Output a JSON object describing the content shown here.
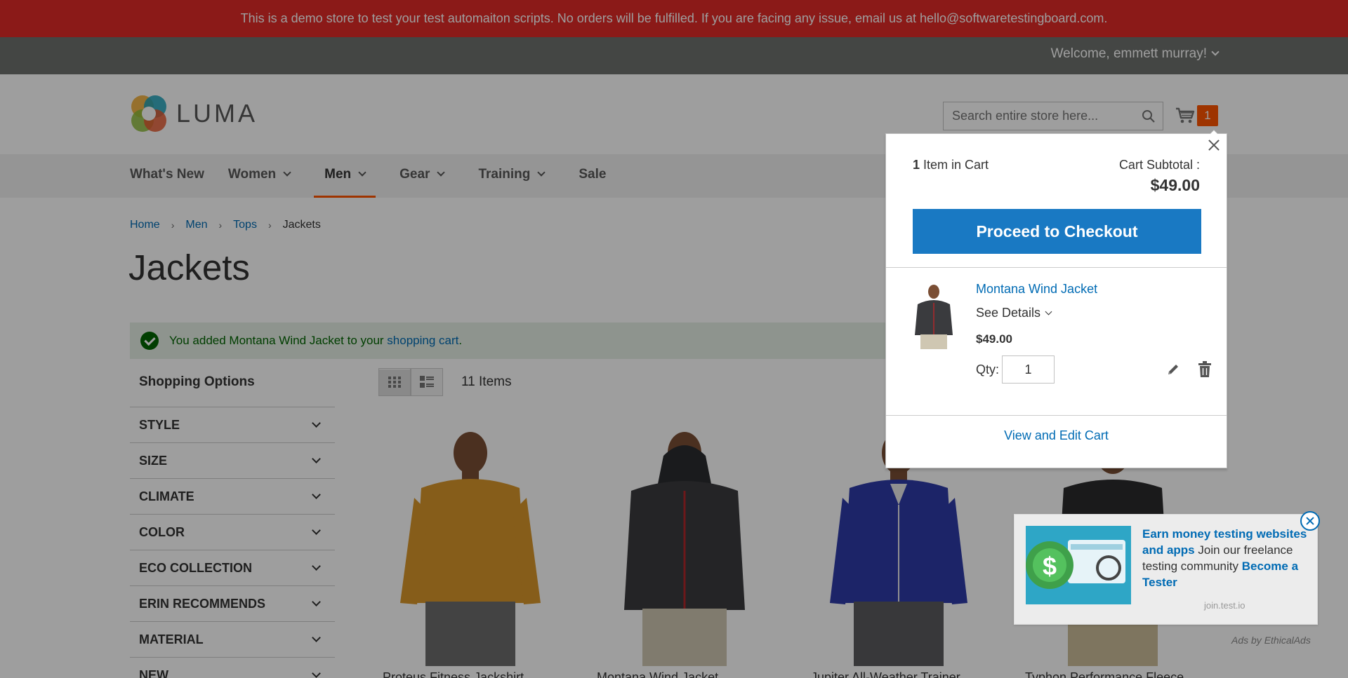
{
  "demo_notice": "This is a demo store to test your test automaiton scripts. No orders will be fulfilled. If you are facing any issue, email us at hello@softwaretestingboard.com.",
  "header": {
    "welcome": "Welcome, emmett murray!",
    "logo_text": "LUMA",
    "search_placeholder": "Search entire store here...",
    "cart_count": "1"
  },
  "nav": {
    "items": [
      {
        "label": "What's New"
      },
      {
        "label": "Women"
      },
      {
        "label": "Men"
      },
      {
        "label": "Gear"
      },
      {
        "label": "Training"
      },
      {
        "label": "Sale"
      }
    ]
  },
  "breadcrumbs": {
    "home": "Home",
    "men": "Men",
    "tops": "Tops",
    "current": "Jackets",
    "separator": "›"
  },
  "page_title": "Jackets",
  "message": {
    "prefix": "You added Montana Wind Jacket to your ",
    "link": "shopping cart",
    "suffix": "."
  },
  "sidebar": {
    "title": "Shopping Options",
    "filters": [
      "Style",
      "Size",
      "Climate",
      "Color",
      "Eco Collection",
      "Erin Recommends",
      "Material",
      "New"
    ]
  },
  "toolbar": {
    "count": "11",
    "count_label": "Items"
  },
  "products": [
    {
      "name": "Proteus Fitness Jackshirt",
      "color": "#d9962a"
    },
    {
      "name": "Montana Wind Jacket",
      "color": "#3a3b3e"
    },
    {
      "name": "Jupiter All-Weather Trainer",
      "color": "#2e3aa8"
    },
    {
      "name": "Typhon Performance Fleece",
      "color": "#2a2a2c"
    }
  ],
  "minicart": {
    "items_count": "1",
    "items_label": "Item in Cart",
    "subtotal_label": "Cart Subtotal :",
    "subtotal": "$49.00",
    "checkout_label": "Proceed to Checkout",
    "item": {
      "name": "Montana Wind Jacket",
      "details_label": "See Details",
      "price": "$49.00",
      "qty_label": "Qty:",
      "qty": "1"
    },
    "view_cart_label": "View and Edit Cart"
  },
  "ad": {
    "headline": "Earn money testing websites and apps",
    "body": "Join our freelance testing community",
    "cta": "Become a Tester",
    "domain": "join.test.io",
    "attribution": "Ads by EthicalAds"
  },
  "colors": {
    "accent": "#ff5501",
    "link": "#006bb4",
    "primary_button": "#1979c3",
    "banner": "#e02b27"
  }
}
